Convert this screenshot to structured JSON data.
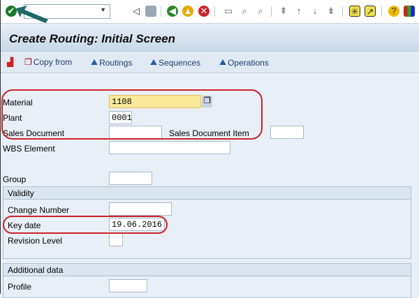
{
  "toolbar": {
    "command_field": "",
    "icons": [
      "enter-icon",
      "back-icon",
      "save-icon",
      "back-nav-icon",
      "exit-icon",
      "cancel-icon",
      "print-icon",
      "find-icon",
      "find-next-icon",
      "first-page-icon",
      "prev-page-icon",
      "next-page-icon",
      "last-page-icon",
      "new-session-icon",
      "shortcut-icon",
      "help-icon",
      "layout-icon"
    ]
  },
  "title": "Create Routing: Initial Screen",
  "app_toolbar": {
    "copy_from": "Copy from",
    "routings": "Routings",
    "sequences": "Sequences",
    "operations": "Operations"
  },
  "form": {
    "material_label": "Material",
    "material_value": "1108",
    "plant_label": "Plant",
    "plant_value": "0001",
    "sales_doc_label": "Sales Document",
    "sales_doc_value": "",
    "sales_doc_item_label": "Sales Document Item",
    "sales_doc_item_value": "",
    "wbs_label": "WBS Element",
    "wbs_value": "",
    "group_label": "Group",
    "group_value": ""
  },
  "validity": {
    "header": "Validity",
    "change_number_label": "Change Number",
    "change_number_value": "",
    "key_date_label": "Key date",
    "key_date_value": "19.06.2016",
    "revision_label": "Revision Level",
    "revision_value": ""
  },
  "additional": {
    "header": "Additional data",
    "profile_label": "Profile",
    "profile_value": ""
  },
  "colors": {
    "highlight": "#c8242c",
    "focus_field": "#fbe99a",
    "arrow": "#1e6a66"
  }
}
